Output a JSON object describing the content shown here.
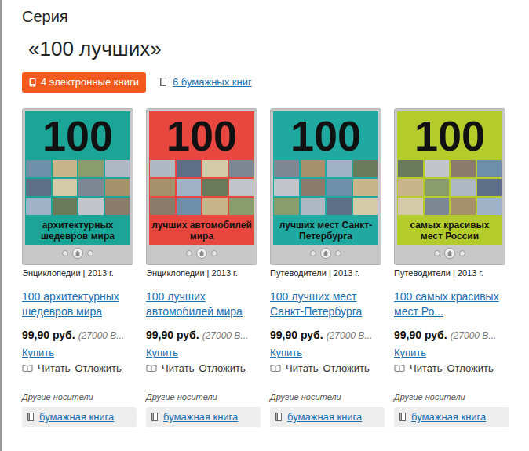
{
  "series": {
    "label": "Серия",
    "title": "«100 лучших»"
  },
  "tabs": [
    {
      "label": "4 электронные книги",
      "selected": true
    },
    {
      "label": "6 бумажных книг",
      "selected": false
    }
  ],
  "books": [
    {
      "cover_number": "100",
      "cover_title": "архитектурных шедевров мира",
      "color": "#1aa597",
      "meta": "Энциклопедии | 2013 г.",
      "title": "100 архитектурных шедевров мира",
      "price": "99,90 руб.",
      "bonus": "(27000 В...",
      "buy": "Купить",
      "read": "Читать",
      "defer": "Отложить",
      "other_label": "Другие носители",
      "other_format": "бумажная книга"
    },
    {
      "cover_number": "100",
      "cover_title": "лучших автомобилей мира",
      "color": "#e8473f",
      "meta": "Энциклопедии | 2013 г.",
      "title": "100 лучших автомобилей мира",
      "price": "99,90 руб.",
      "bonus": "(27000 В...",
      "buy": "Купить",
      "read": "Читать",
      "defer": "Отложить",
      "other_label": "Другие носители",
      "other_format": "бумажная книга"
    },
    {
      "cover_number": "100",
      "cover_title": "лучших мест Санкт-Петербурга",
      "color": "#1fa9a1",
      "meta": "Путеводители | 2013 г.",
      "title": "100 лучших мест Санкт-Петербурга",
      "price": "99,90 руб.",
      "bonus": "(27000 В...",
      "buy": "Купить",
      "read": "Читать",
      "defer": "Отложить",
      "other_label": "Другие носители",
      "other_format": "бумажная книга"
    },
    {
      "cover_number": "100",
      "cover_title": "самых красивых мест России",
      "color": "#b3cc2c",
      "meta": "Путеводители | 2013 г.",
      "title": "100 самых красивых мест Ро...",
      "price": "99,90 руб.",
      "bonus": "(27000 В...",
      "buy": "Купить",
      "read": "Читать",
      "defer": "Отложить",
      "other_label": "Другие носители",
      "other_format": "бумажная книга"
    }
  ]
}
